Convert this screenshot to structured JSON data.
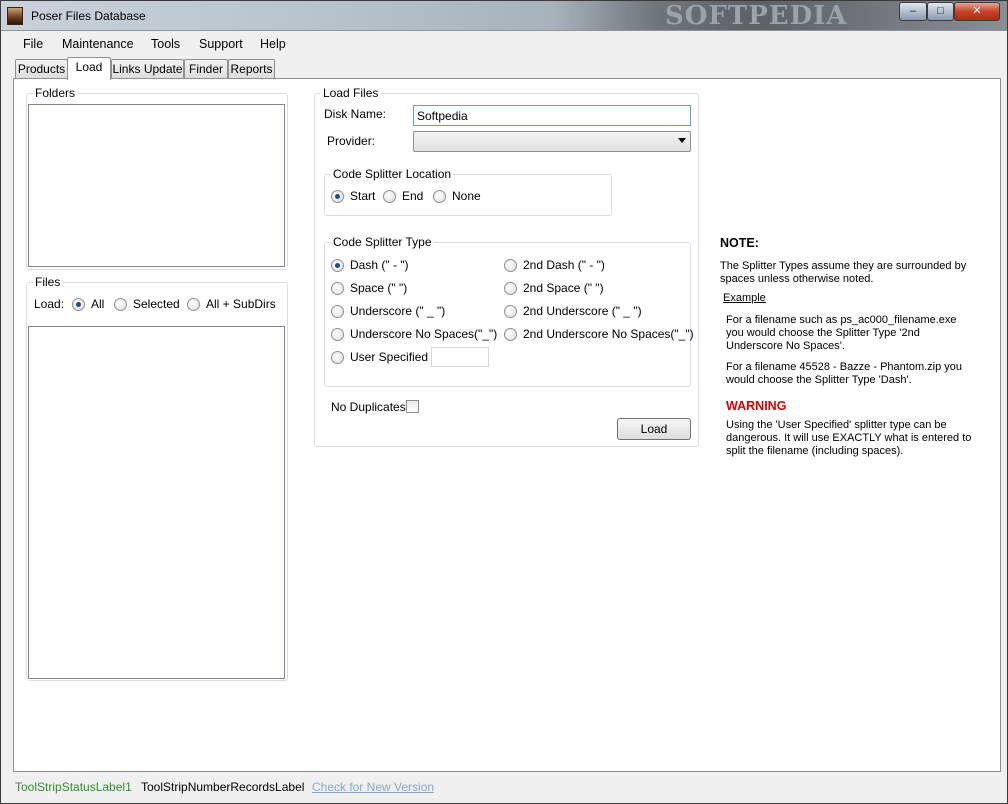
{
  "window": {
    "title": "Poser Files Database",
    "watermark": "SOFTPEDIA",
    "controls": {
      "minimize": "–",
      "maximize": "□",
      "close": "✕"
    }
  },
  "menu": [
    "File",
    "Maintenance",
    "Tools",
    "Support",
    "Help"
  ],
  "tabs": [
    "Products",
    "Load",
    "Links Update",
    "Finder",
    "Reports"
  ],
  "active_tab": "Load",
  "folders": {
    "title": "Folders"
  },
  "files": {
    "title": "Files",
    "load_label": "Load:",
    "options": [
      "All",
      "Selected",
      "All + SubDirs"
    ],
    "selected": "All"
  },
  "load_files": {
    "title": "Load Files",
    "disk_name_label": "Disk Name:",
    "disk_name_value": "Softpedia",
    "provider_label": "Provider:",
    "provider_value": "",
    "location": {
      "title": "Code Splitter Location",
      "options": [
        "Start",
        "End",
        "None"
      ],
      "selected": "Start"
    },
    "type": {
      "title": "Code Splitter Type",
      "left": [
        "Dash (\" - \")",
        "Space (\" \")",
        "Underscore (\" _ \")",
        "Underscore No Spaces(\"_\")",
        "User Specified"
      ],
      "right": [
        "2nd Dash (\" - \")",
        "2nd Space (\" \")",
        "2nd Underscore (\" _ \")",
        "2nd Underscore No Spaces(\"_\")"
      ],
      "selected": "Dash (\" - \")",
      "user_specified_value": ""
    },
    "no_duplicates_label": "No Duplicates",
    "no_duplicates_checked": false,
    "load_button": "Load"
  },
  "note": {
    "heading": "NOTE:",
    "intro": "The Splitter Types assume they are surrounded by spaces unless otherwise noted.",
    "example_label": "Example",
    "example1": "For a filename such as ps_ac000_filename.exe you would choose the Splitter Type '2nd Underscore No Spaces'.",
    "example2": "For a filename 45528 - Bazze - Phantom.zip you would choose the Splitter Type 'Dash'.",
    "warning_heading": "WARNING",
    "warning_text": "Using the 'User Specified' splitter type can be dangerous. It will use EXACTLY what is entered to split the filename (including spaces)."
  },
  "status": {
    "label1": "ToolStripStatusLabel1",
    "records": "ToolStripNumberRecordsLabel",
    "link": "Check for New Version"
  },
  "colors": {
    "status_label": "#2f8f2f",
    "link": "#8ba8c9",
    "warning": "#e00000"
  }
}
